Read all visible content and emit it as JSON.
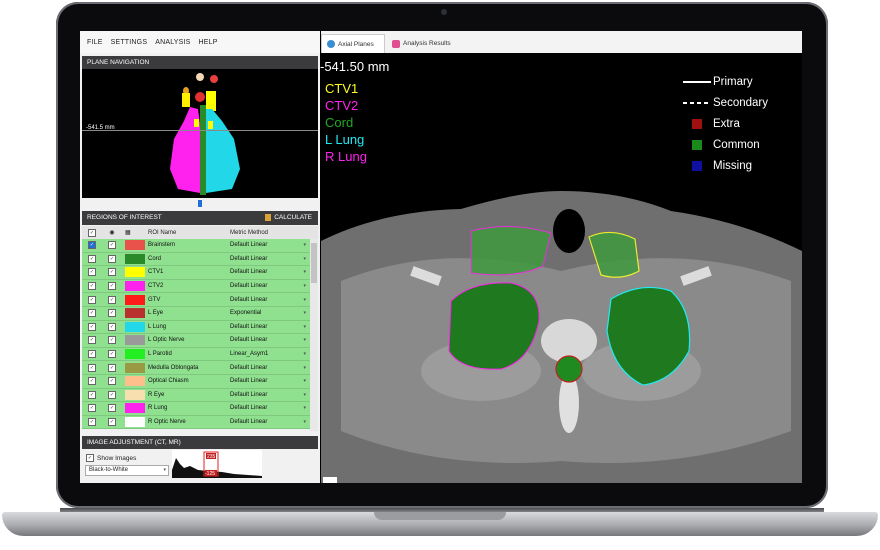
{
  "menu": [
    "FILE",
    "SETTINGS",
    "ANALYSIS",
    "HELP"
  ],
  "plane_navigation": {
    "title": "PLANE NAVIGATION",
    "position_label": "-541.5 mm"
  },
  "regions": {
    "title": "REGIONS OF INTEREST",
    "calculate_label": "CALCULATE",
    "columns": {
      "name": "ROI Name",
      "method": "Metric Method"
    },
    "rows": [
      {
        "name": "Brainstem",
        "color": "#e8524a",
        "method": "Default Linear"
      },
      {
        "name": "Cord",
        "color": "#2a8a2a",
        "method": "Default Linear"
      },
      {
        "name": "CTV1",
        "color": "#ffff00",
        "method": "Default Linear"
      },
      {
        "name": "CTV2",
        "color": "#ff22ee",
        "method": "Default Linear"
      },
      {
        "name": "GTV",
        "color": "#ff1a1a",
        "method": "Default Linear"
      },
      {
        "name": "L Eye",
        "color": "#b8312e",
        "method": "Exponential"
      },
      {
        "name": "L Lung",
        "color": "#22d8e8",
        "method": "Default Linear"
      },
      {
        "name": "L Optic Nerve",
        "color": "#9a9a9a",
        "method": "Default Linear"
      },
      {
        "name": "L Parotid",
        "color": "#22ee22",
        "method": "Linear_Asym1"
      },
      {
        "name": "Medulla Oblongata",
        "color": "#9a9a44",
        "method": "Default Linear"
      },
      {
        "name": "Optical Chiasm",
        "color": "#ffbf8c",
        "method": "Default Linear"
      },
      {
        "name": "R Eye",
        "color": "#f7dfb0",
        "method": "Default Linear"
      },
      {
        "name": "R Lung",
        "color": "#ff22ee",
        "method": "Default Linear"
      },
      {
        "name": "R Optic Nerve",
        "color": "#ffffff",
        "method": "Default Linear"
      }
    ]
  },
  "image_adjustment": {
    "title": "IMAGE ADJUSTMENT (CT, MR)",
    "show_images_label": "Show Images",
    "colormap": "Black-to-White",
    "hist_high": "235",
    "hist_low": "-125"
  },
  "tabs": [
    {
      "label": "Axial Planes"
    },
    {
      "label": "Analysis Results"
    }
  ],
  "viewer": {
    "depth": "-541.50 mm",
    "roi_labels": [
      {
        "name": "CTV1",
        "color": "#ffff22"
      },
      {
        "name": "CTV2",
        "color": "#ff22ee"
      },
      {
        "name": "Cord",
        "color": "#22a822"
      },
      {
        "name": "L Lung",
        "color": "#22e8f2"
      },
      {
        "name": "R Lung",
        "color": "#ff22ee"
      }
    ],
    "legend": {
      "primary": "Primary",
      "secondary": "Secondary",
      "extra": "Extra",
      "common": "Common",
      "missing": "Missing",
      "colors": {
        "extra": "#a01010",
        "common": "#1a8a1a",
        "missing": "#1010a0"
      }
    }
  }
}
